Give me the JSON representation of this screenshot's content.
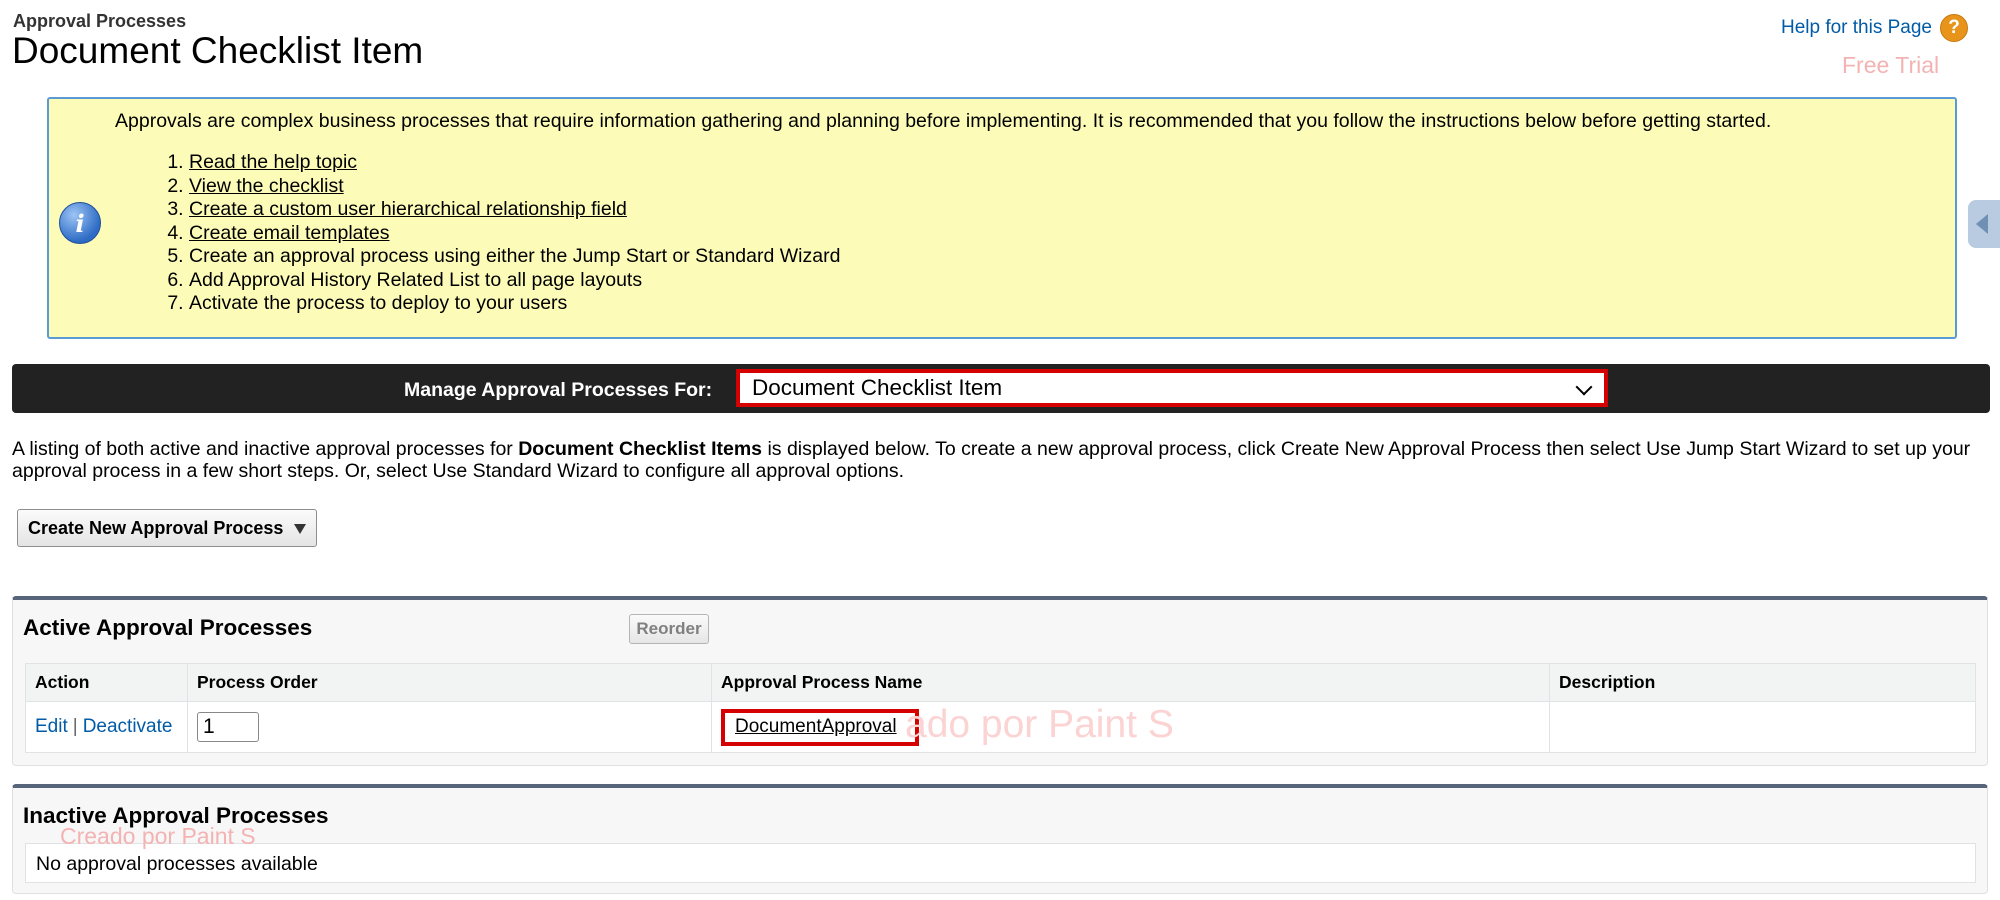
{
  "header": {
    "breadcrumb": "Approval Processes",
    "title": "Document Checklist Item",
    "help_link": "Help for this Page",
    "help_icon": "?"
  },
  "watermarks": {
    "top": "Free Trial",
    "middle": "ado por Paint S",
    "bottom": "Creado por Paint S"
  },
  "info": {
    "intro": "Approvals are complex business processes that require information gathering and planning before implementing. It is recommended that you follow the instructions below before getting started.",
    "steps": [
      {
        "label": "Read the help topic",
        "link": true
      },
      {
        "label": "View the checklist",
        "link": true
      },
      {
        "label": "Create a custom user hierarchical relationship field",
        "link": true
      },
      {
        "label": "Create email templates",
        "link": true
      },
      {
        "label": "Create an approval process using either the Jump Start or Standard Wizard",
        "link": false
      },
      {
        "label": "Add Approval History Related List to all page layouts",
        "link": false
      },
      {
        "label": "Activate the process to deploy to your users",
        "link": false
      }
    ]
  },
  "manage": {
    "label": "Manage Approval Processes For:",
    "selected_object": "Document Checklist Item"
  },
  "listing": {
    "text_before": "A listing of both active and inactive approval processes for ",
    "object_plural": "Document Checklist Items",
    "text_after": " is displayed below. To create a new approval process, click Create New Approval Process then select Use Jump Start Wizard to set up your approval process in a few short steps. Or, select Use Standard Wizard to configure all approval options."
  },
  "create_button": "Create New Approval Process",
  "active_section": {
    "title": "Active Approval Processes",
    "reorder_label": "Reorder",
    "columns": [
      "Action",
      "Process Order",
      "Approval Process Name",
      "Description"
    ],
    "rows": [
      {
        "edit": "Edit",
        "separator": "|",
        "deactivate": "Deactivate",
        "order": "1",
        "name": "DocumentApproval",
        "description": ""
      }
    ]
  },
  "inactive_section": {
    "title": "Inactive Approval Processes",
    "empty_message": "No approval processes available"
  },
  "colors": {
    "link": "#015ba7",
    "highlight": "#d50000",
    "info_bg": "#fcfcb8",
    "manage_bar": "#222222"
  }
}
